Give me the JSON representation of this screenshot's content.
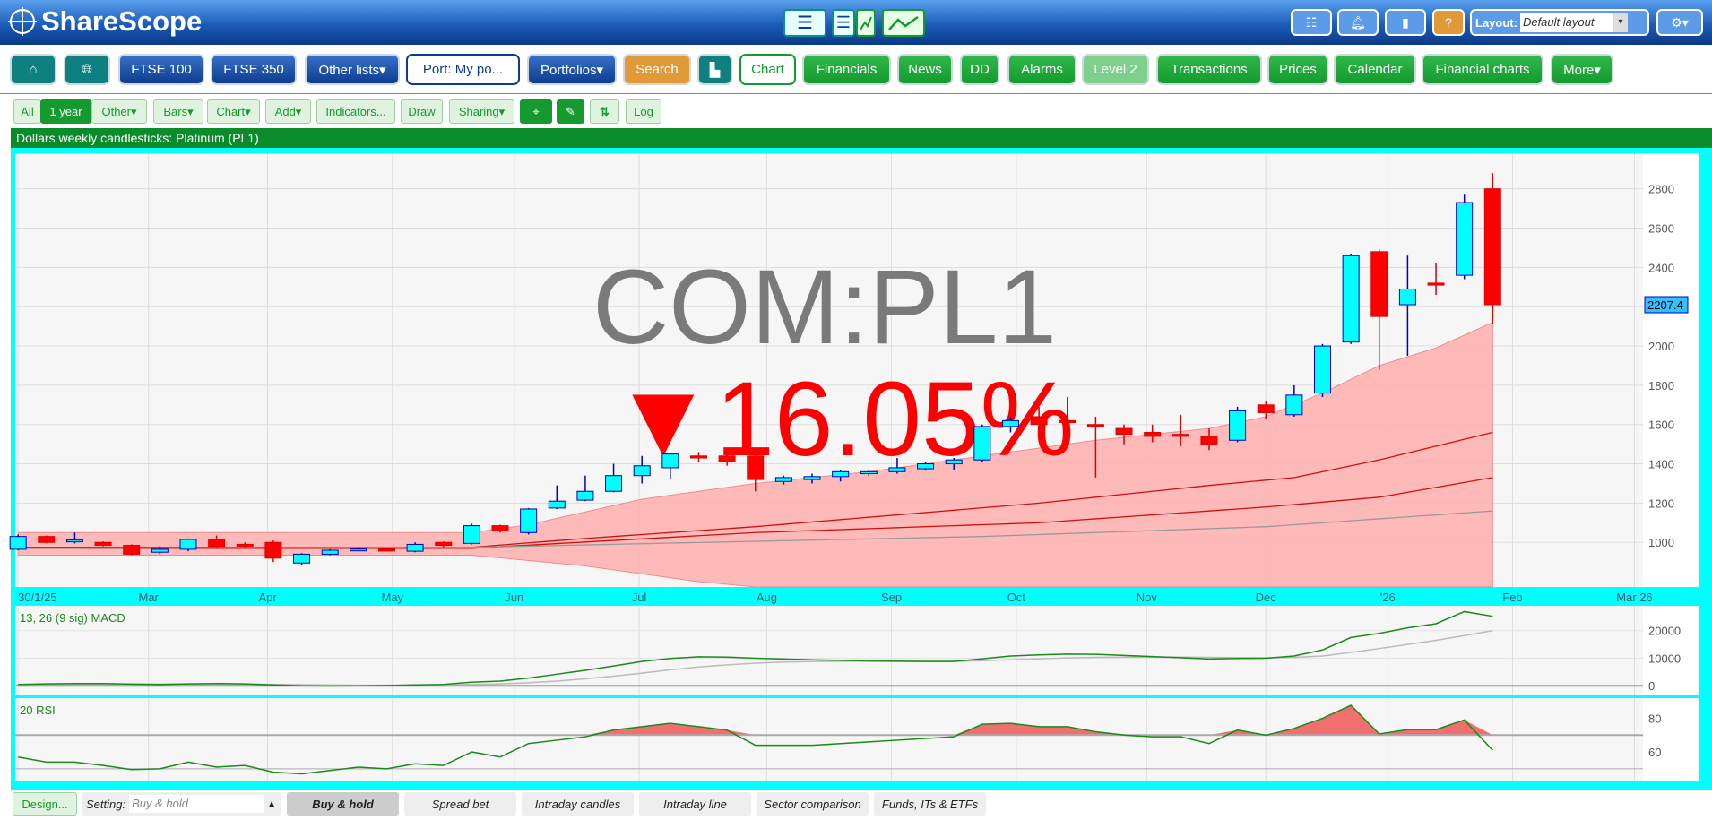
{
  "app": {
    "title": "ShareScope"
  },
  "header": {
    "layout_label": "Layout:",
    "layout_value": "Default layout",
    "help": "?",
    "icons": [
      "list-icon",
      "bell-icon",
      "chat-icon",
      "help-icon",
      "gear-icon"
    ]
  },
  "nav": {
    "ftse100": "FTSE 100",
    "ftse350": "FTSE 350",
    "other_lists": "Other lists▾",
    "port": "Port: My po...",
    "portfolios": "Portfolios▾",
    "search": "Search",
    "chart": "Chart",
    "financials": "Financials",
    "news": "News",
    "dd": "DD",
    "alarms": "Alarms",
    "level2": "Level 2",
    "transactions": "Transactions",
    "prices": "Prices",
    "calendar": "Calendar",
    "financial_charts": "Financial charts",
    "more": "More▾"
  },
  "toolbar": {
    "all": "All",
    "year": "1 year",
    "other": "Other▾",
    "bars": "Bars▾",
    "chart": "Chart▾",
    "add": "Add▾",
    "indicators": "Indicators...",
    "draw": "Draw",
    "sharing": "Sharing▾",
    "log": "Log"
  },
  "chart_title": "Dollars weekly candlesticks: Platinum (PL1)",
  "watermark": {
    "symbol": "COM:PL1",
    "change": "▼16.05%"
  },
  "chart_data": [
    {
      "type": "candlestick",
      "title": "Dollars weekly candlesticks: Platinum (PL1)",
      "ylim": [
        773,
        2981
      ],
      "xlim": [
        -0.1,
        57.3
      ],
      "yticks": [
        1000,
        1200,
        1400,
        1600,
        1800,
        2000,
        2200,
        2400,
        2600,
        2800
      ],
      "last_price": "2207.4",
      "last_price_value": 2210,
      "xticks": [
        {
          "w": 0,
          "label": "30/1/25"
        },
        {
          "w": 4.6,
          "label": "Mar"
        },
        {
          "w": 8.8,
          "label": "Apr"
        },
        {
          "w": 13.2,
          "label": "May"
        },
        {
          "w": 17.5,
          "label": "Jun"
        },
        {
          "w": 21.9,
          "label": "Jul"
        },
        {
          "w": 26.4,
          "label": "Aug"
        },
        {
          "w": 30.8,
          "label": "Sep"
        },
        {
          "w": 35.2,
          "label": "Oct"
        },
        {
          "w": 39.8,
          "label": "Nov"
        },
        {
          "w": 44,
          "label": "Dec"
        },
        {
          "w": 48.3,
          "label": "'26"
        },
        {
          "w": 52.7,
          "label": "Feb"
        },
        {
          "w": 57,
          "label": "Mar 26"
        }
      ],
      "ohlc": [
        [
          965,
          1040,
          960,
          1030
        ],
        [
          1030,
          1035,
          995,
          1000
        ],
        [
          1005,
          1050,
          995,
          1012
        ],
        [
          1000,
          1005,
          980,
          985
        ],
        [
          985,
          990,
          935,
          940
        ],
        [
          950,
          980,
          940,
          965
        ],
        [
          965,
          1020,
          955,
          1015
        ],
        [
          1015,
          1035,
          975,
          980
        ],
        [
          990,
          1000,
          975,
          985
        ],
        [
          1000,
          1010,
          900,
          920
        ],
        [
          895,
          945,
          885,
          940
        ],
        [
          940,
          965,
          935,
          960
        ],
        [
          962,
          975,
          955,
          966
        ],
        [
          965,
          972,
          958,
          960
        ],
        [
          955,
          1000,
          950,
          990
        ],
        [
          1000,
          1005,
          975,
          985
        ],
        [
          995,
          1095,
          990,
          1085
        ],
        [
          1085,
          1090,
          1050,
          1060
        ],
        [
          1050,
          1175,
          1040,
          1170
        ],
        [
          1175,
          1290,
          1170,
          1210
        ],
        [
          1215,
          1340,
          1210,
          1260
        ],
        [
          1260,
          1400,
          1255,
          1340
        ],
        [
          1340,
          1440,
          1300,
          1390
        ],
        [
          1380,
          1450,
          1320,
          1450
        ],
        [
          1440,
          1460,
          1410,
          1430
        ],
        [
          1440,
          1460,
          1390,
          1410
        ],
        [
          1440,
          1455,
          1260,
          1320
        ],
        [
          1310,
          1340,
          1295,
          1330
        ],
        [
          1320,
          1350,
          1300,
          1335
        ],
        [
          1335,
          1370,
          1310,
          1360
        ],
        [
          1350,
          1370,
          1340,
          1360
        ],
        [
          1360,
          1430,
          1350,
          1380
        ],
        [
          1375,
          1410,
          1370,
          1400
        ],
        [
          1400,
          1430,
          1370,
          1420
        ],
        [
          1420,
          1600,
          1410,
          1590
        ],
        [
          1590,
          1640,
          1560,
          1620
        ],
        [
          1640,
          1690,
          1540,
          1600
        ],
        [
          1620,
          1740,
          1560,
          1610
        ],
        [
          1600,
          1640,
          1330,
          1590
        ],
        [
          1580,
          1600,
          1500,
          1550
        ],
        [
          1560,
          1600,
          1510,
          1540
        ],
        [
          1550,
          1650,
          1490,
          1540
        ],
        [
          1540,
          1580,
          1470,
          1500
        ],
        [
          1520,
          1690,
          1510,
          1670
        ],
        [
          1700,
          1720,
          1630,
          1660
        ],
        [
          1650,
          1800,
          1640,
          1750
        ],
        [
          1760,
          2010,
          1740,
          2000
        ],
        [
          2020,
          2470,
          2010,
          2460
        ],
        [
          2480,
          2490,
          1880,
          2150
        ],
        [
          2210,
          2460,
          1950,
          2290
        ],
        [
          2320,
          2420,
          2260,
          2310
        ],
        [
          2360,
          2770,
          2340,
          2730
        ],
        [
          2800,
          2880,
          2110,
          2210
        ]
      ],
      "bollinger_upper": [
        [
          0,
          1050
        ],
        [
          16,
          1050
        ],
        [
          18,
          1090
        ],
        [
          22,
          1220
        ],
        [
          26,
          1300
        ],
        [
          30,
          1360
        ],
        [
          34,
          1440
        ],
        [
          38,
          1520
        ],
        [
          42,
          1580
        ],
        [
          44,
          1640
        ],
        [
          46,
          1760
        ],
        [
          48,
          1900
        ],
        [
          50,
          1990
        ],
        [
          52,
          2120
        ]
      ],
      "bollinger_lower": [
        [
          0,
          935
        ],
        [
          16,
          935
        ],
        [
          20,
          880
        ],
        [
          24,
          800
        ],
        [
          27,
          760
        ],
        [
          52,
          700
        ]
      ],
      "ma_1": [
        [
          0,
          975
        ],
        [
          16,
          975
        ],
        [
          20,
          1020
        ],
        [
          26,
          1080
        ],
        [
          36,
          1200
        ],
        [
          42,
          1290
        ],
        [
          45,
          1330
        ],
        [
          48,
          1420
        ],
        [
          52,
          1560
        ]
      ],
      "ma_2": [
        [
          0,
          970
        ],
        [
          16,
          970
        ],
        [
          26,
          1050
        ],
        [
          36,
          1100
        ],
        [
          44,
          1180
        ],
        [
          48,
          1230
        ],
        [
          52,
          1330
        ]
      ],
      "ma_3": [
        [
          0,
          970
        ],
        [
          16,
          975
        ],
        [
          34,
          1030
        ],
        [
          44,
          1080
        ],
        [
          52,
          1160
        ]
      ]
    },
    {
      "type": "line",
      "title": "13, 26 (9 sig) MACD",
      "ylim": [
        -3500,
        29000
      ],
      "yticks": [
        0,
        10000,
        20000
      ],
      "macd_k": [
        0.5,
        0.7,
        0.8,
        0.8,
        0.6,
        0.5,
        0.7,
        0.8,
        0.7,
        0.3,
        0,
        -0.1,
        0,
        0.1,
        0.3,
        0.5,
        1.3,
        1.7,
        2.8,
        4.2,
        5.6,
        7.2,
        8.8,
        9.9,
        10.5,
        10.4,
        10.0,
        9.7,
        9.4,
        9.2,
        9.0,
        8.9,
        8.8,
        8.8,
        9.8,
        10.8,
        11.2,
        11.5,
        11.4,
        11.0,
        10.6,
        10.2,
        9.7,
        9.9,
        10.0,
        10.8,
        13.0,
        17.5,
        19.0,
        21.0,
        22.5,
        26.9,
        25.2
      ],
      "signal_k": [
        0.4,
        0.5,
        0.6,
        0.6,
        0.6,
        0.6,
        0.6,
        0.6,
        0.6,
        0.5,
        0.4,
        0.3,
        0.2,
        0.2,
        0.2,
        0.3,
        0.5,
        0.7,
        1.1,
        1.7,
        2.5,
        3.5,
        4.6,
        5.8,
        6.8,
        7.6,
        8.2,
        8.6,
        8.8,
        8.9,
        8.9,
        8.9,
        8.9,
        8.9,
        9.1,
        9.4,
        9.8,
        10.1,
        10.3,
        10.4,
        10.4,
        10.4,
        10.3,
        10.2,
        10.2,
        10.3,
        10.8,
        12.1,
        13.5,
        15.0,
        16.5,
        18.2,
        20.0
      ]
    },
    {
      "type": "line",
      "title": "20 RSI",
      "ylim": [
        43,
        92
      ],
      "yticks": [
        60,
        80
      ],
      "threshold": 70,
      "values": [
        57,
        54,
        54,
        52,
        49.5,
        50,
        54,
        51,
        52,
        48,
        47,
        49,
        51,
        50,
        53,
        52,
        60,
        57,
        65,
        67,
        69,
        73,
        75,
        77,
        75,
        73,
        64,
        64,
        64,
        65,
        66,
        67,
        68,
        69,
        76.5,
        77,
        75,
        75,
        72,
        70,
        69,
        69,
        65,
        73,
        70,
        74,
        80,
        87.7,
        70.7,
        73.3,
        73.3,
        79,
        61
      ]
    }
  ],
  "bottom": {
    "design": "Design...",
    "setting_label": "Setting:",
    "setting_value": "Buy & hold",
    "presets": [
      "Buy & hold",
      "Spread bet",
      "Intraday candles",
      "Intraday line",
      "Sector comparison",
      "Funds, ITs & ETFs"
    ]
  }
}
